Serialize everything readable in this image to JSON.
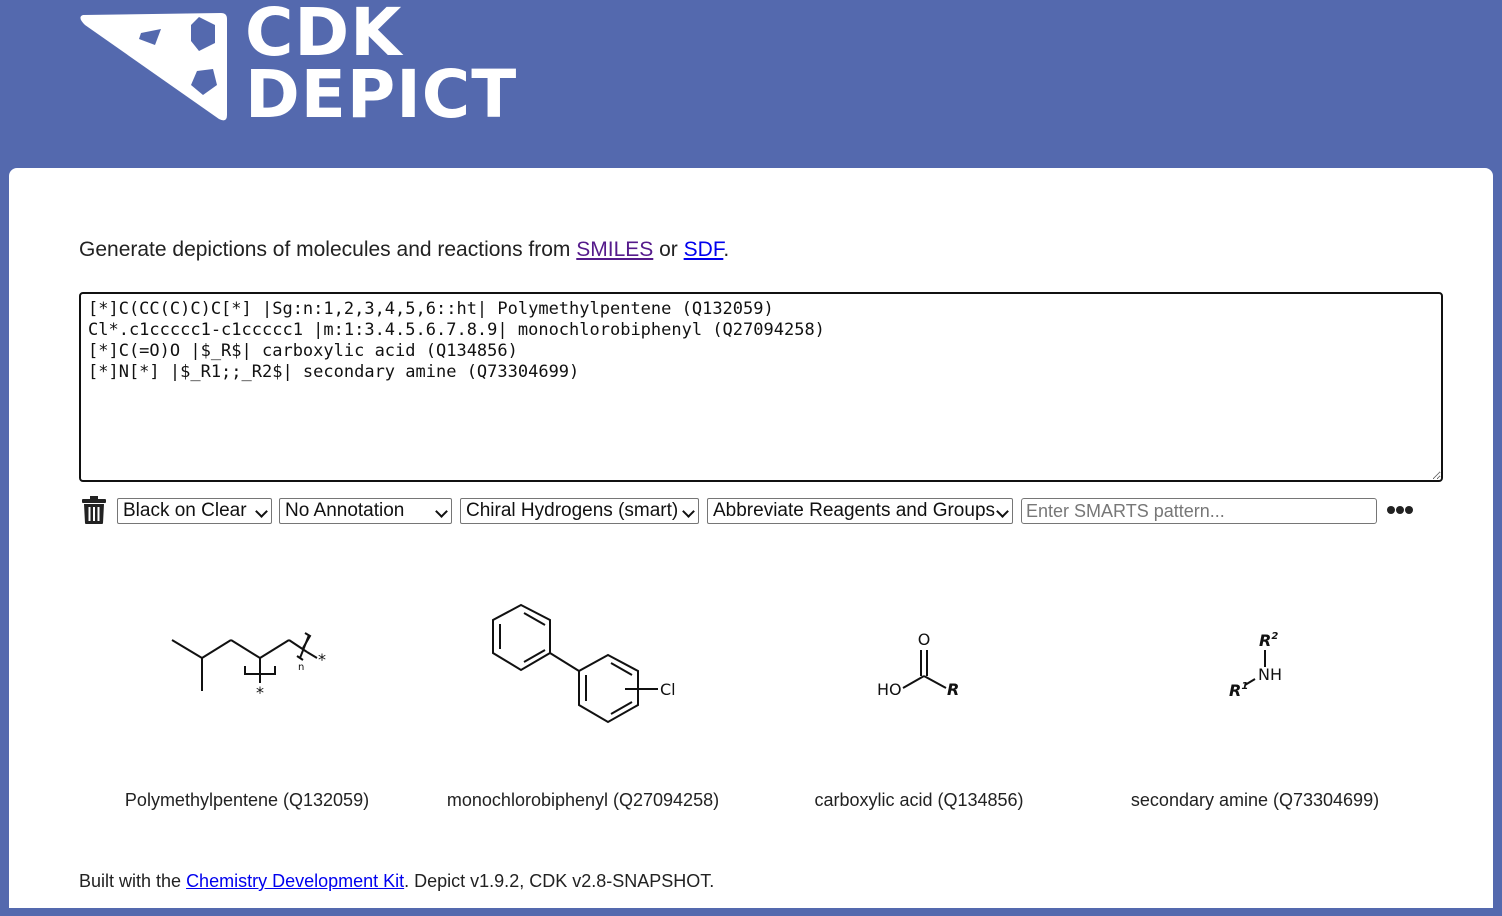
{
  "header": {
    "logo_line1": "CDK",
    "logo_line2": "DEPICT",
    "brand_color": "#5469ae"
  },
  "intro": {
    "text_before": "Generate depictions of molecules and reactions from ",
    "link_smiles": "SMILES",
    "text_middle": " or ",
    "link_sdf": "SDF",
    "text_after": "."
  },
  "input": {
    "value": "[*]C(CC(C)C)C[*] |Sg:n:1,2,3,4,5,6::ht| Polymethylpentene (Q132059)\nCl*.c1ccccc1-c1ccccc1 |m:1:3.4.5.6.7.8.9| monochlorobiphenyl (Q27094258)\n[*]C(=O)O |$_R$| carboxylic acid (Q134856)\n[*]N[*] |$_R1;;_R2$| secondary amine (Q73304699)"
  },
  "toolbar": {
    "trash_icon": "trash-icon",
    "style_select": "Black on Clear",
    "annotation_select": "No Annotation",
    "hydrogen_select": "Chiral Hydrogens (smart)",
    "abbreviation_select": "Abbreviate Reagents and Groups",
    "smarts_placeholder": "Enter SMARTS pattern...",
    "smarts_value": "",
    "more_icon": "ellipsis-icon"
  },
  "molecules": [
    {
      "caption": "Polymethylpentene (Q132059)",
      "labels": {
        "star1": "*",
        "star2": "*",
        "n": "n"
      }
    },
    {
      "caption": "monochlorobiphenyl (Q27094258)",
      "labels": {
        "cl": "Cl"
      }
    },
    {
      "caption": "carboxylic acid (Q134856)",
      "labels": {
        "o": "O",
        "ho": "HO",
        "r": "R"
      }
    },
    {
      "caption": "secondary amine (Q73304699)",
      "labels": {
        "r2": "R",
        "r2sup": "2",
        "nh": "NH",
        "r1": "R",
        "r1sup": "1"
      }
    }
  ],
  "footer": {
    "text_before": "Built with the ",
    "link_cdk": "Chemistry Development Kit",
    "text_after": ". Depict v1.9.2, CDK v2.8-SNAPSHOT."
  }
}
